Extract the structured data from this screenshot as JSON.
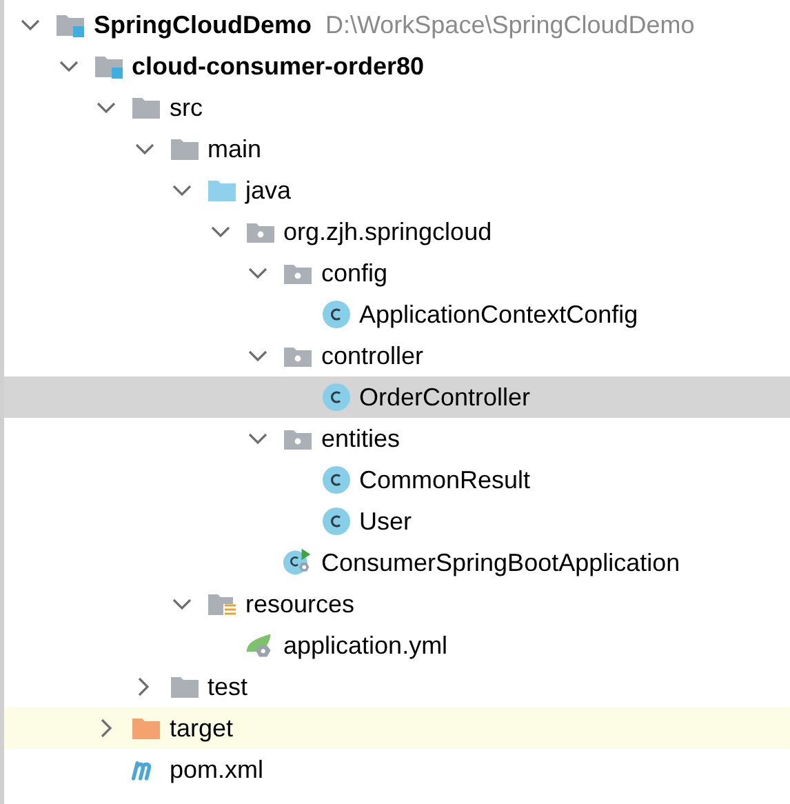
{
  "tree": [
    {
      "label": "SpringCloudDemo",
      "hint": "D:\\WorkSpace\\SpringCloudDemo",
      "kind": "module",
      "bold": true,
      "expanded": true,
      "selected": false,
      "highlighted": false,
      "children": [
        {
          "label": "cloud-consumer-order80",
          "kind": "module",
          "bold": true,
          "expanded": true,
          "selected": false,
          "highlighted": false,
          "children": [
            {
              "label": "src",
              "kind": "folder",
              "bold": false,
              "expanded": true,
              "selected": false,
              "highlighted": false,
              "children": [
                {
                  "label": "main",
                  "kind": "folder",
                  "bold": false,
                  "expanded": true,
                  "selected": false,
                  "highlighted": false,
                  "children": [
                    {
                      "label": "java",
                      "kind": "source",
                      "bold": false,
                      "expanded": true,
                      "selected": false,
                      "highlighted": false,
                      "children": [
                        {
                          "label": "org.zjh.springcloud",
                          "kind": "package",
                          "bold": false,
                          "expanded": true,
                          "selected": false,
                          "highlighted": false,
                          "children": [
                            {
                              "label": "config",
                              "kind": "package",
                              "bold": false,
                              "expanded": true,
                              "selected": false,
                              "highlighted": false,
                              "children": [
                                {
                                  "label": "ApplicationContextConfig",
                                  "kind": "class",
                                  "bold": false,
                                  "selected": false,
                                  "highlighted": false
                                }
                              ]
                            },
                            {
                              "label": "controller",
                              "kind": "package",
                              "bold": false,
                              "expanded": true,
                              "selected": false,
                              "highlighted": false,
                              "children": [
                                {
                                  "label": "OrderController",
                                  "kind": "class",
                                  "bold": false,
                                  "selected": true,
                                  "highlighted": false
                                }
                              ]
                            },
                            {
                              "label": "entities",
                              "kind": "package",
                              "bold": false,
                              "expanded": true,
                              "selected": false,
                              "highlighted": false,
                              "children": [
                                {
                                  "label": "CommonResult",
                                  "kind": "class",
                                  "bold": false,
                                  "selected": false,
                                  "highlighted": false
                                },
                                {
                                  "label": "User",
                                  "kind": "class",
                                  "bold": false,
                                  "selected": false,
                                  "highlighted": false
                                }
                              ]
                            },
                            {
                              "label": "ConsumerSpringBootApplication",
                              "kind": "app",
                              "bold": false,
                              "selected": false,
                              "highlighted": false
                            }
                          ]
                        }
                      ]
                    },
                    {
                      "label": "resources",
                      "kind": "resources",
                      "bold": false,
                      "expanded": true,
                      "selected": false,
                      "highlighted": false,
                      "children": [
                        {
                          "label": "application.yml",
                          "kind": "yml",
                          "bold": false,
                          "selected": false,
                          "highlighted": false
                        }
                      ]
                    }
                  ]
                },
                {
                  "label": "test",
                  "kind": "folder",
                  "bold": false,
                  "expanded": false,
                  "selected": false,
                  "highlighted": false
                }
              ]
            },
            {
              "label": "target",
              "kind": "excluded",
              "bold": false,
              "expanded": false,
              "selected": false,
              "highlighted": true
            },
            {
              "label": "pom.xml",
              "kind": "maven",
              "bold": false,
              "selected": false,
              "highlighted": false
            }
          ]
        }
      ]
    }
  ]
}
